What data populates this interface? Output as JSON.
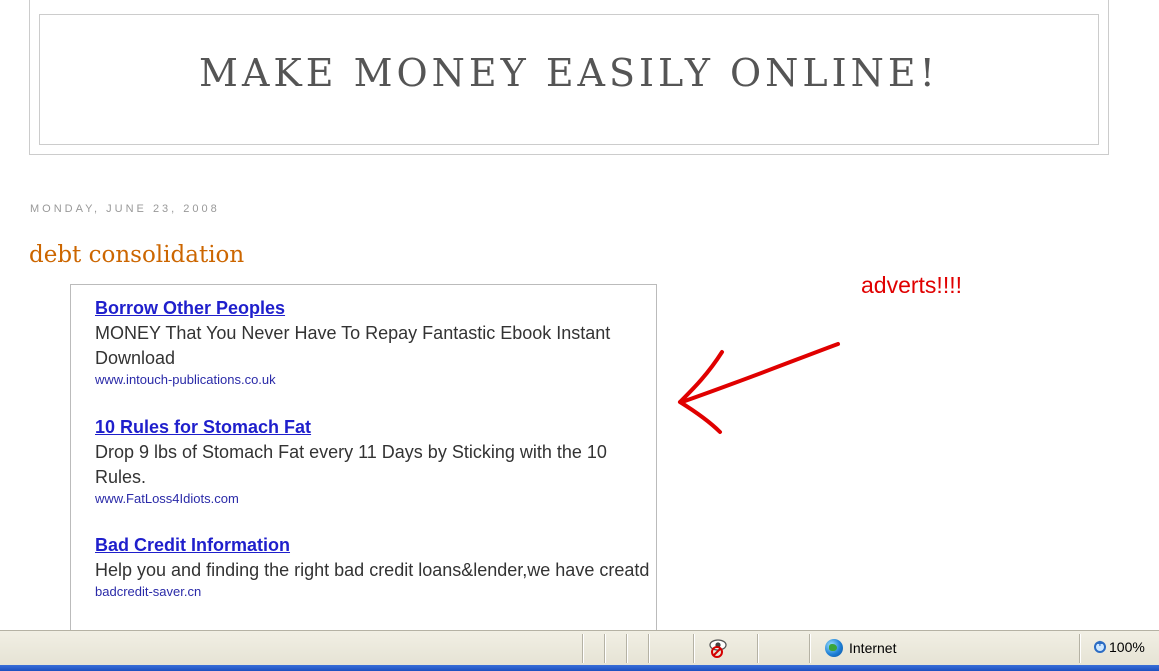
{
  "blog": {
    "title": "MAKE MONEY EASILY ONLINE!"
  },
  "post": {
    "date": "MONDAY, JUNE 23, 2008",
    "title": "debt consolidation"
  },
  "ads": [
    {
      "title": "Borrow Other Peoples",
      "desc": "MONEY That You Never Have To Repay Fantastic Ebook Instant Download",
      "url": "www.intouch-publications.co.uk"
    },
    {
      "title": "10 Rules for Stomach Fat",
      "desc": "Drop 9 lbs of Stomach Fat every 11 Days by Sticking with the 10 Rules.",
      "url": "www.FatLoss4Idiots.com"
    },
    {
      "title": "Bad Credit Information",
      "desc": "Help you and finding the right bad credit loans&lender,we have creatd",
      "url": "badcredit-saver.cn"
    }
  ],
  "annotation": {
    "text": "adverts!!!!",
    "color": "#e00000"
  },
  "statusbar": {
    "zone_label": "Internet",
    "zoom_label": "100%",
    "icons": {
      "privacy": "privacy-report-icon",
      "zone": "internet-zone-globe-icon",
      "zoom": "zoom-icon"
    }
  },
  "colors": {
    "post_title": "#cc6600",
    "ad_link": "#1f1fcc",
    "ad_url": "#2a2aa8",
    "status_blue": "#1c4fbf"
  }
}
